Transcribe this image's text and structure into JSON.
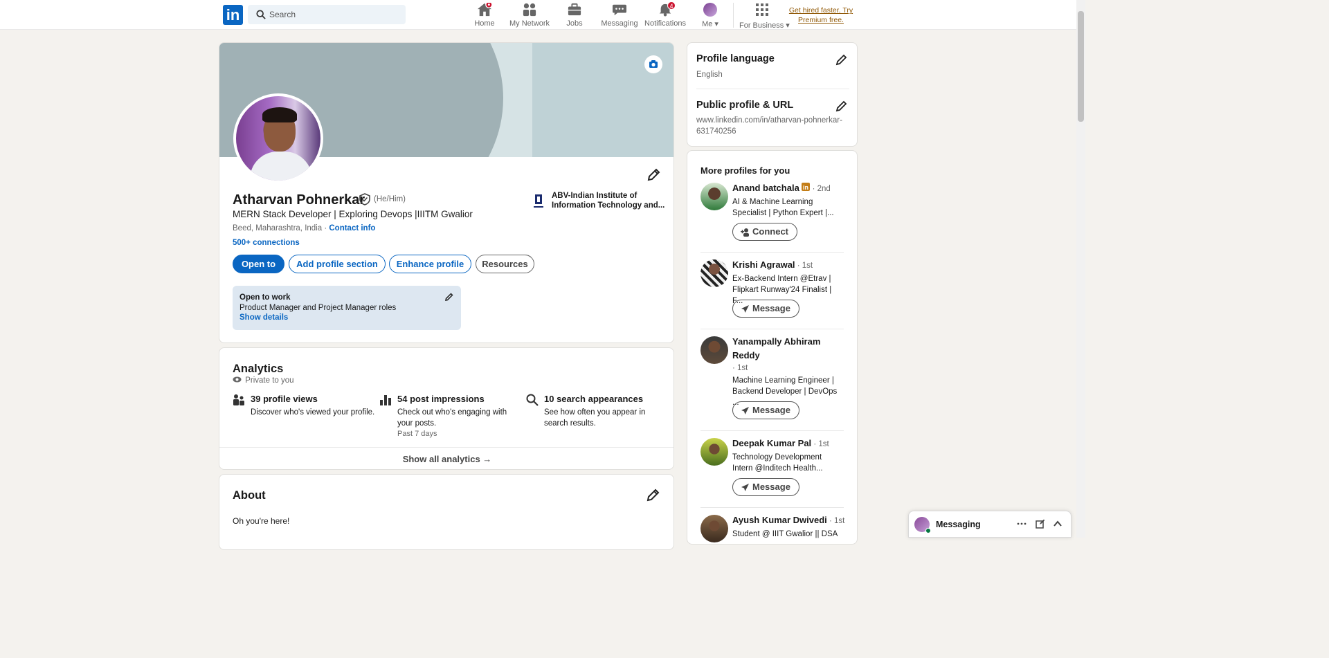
{
  "nav": {
    "search_placeholder": "Search",
    "logo_text": "in",
    "items": [
      {
        "label": "Home",
        "icon": "home-icon",
        "badge": ""
      },
      {
        "label": "My Network",
        "icon": "network-icon",
        "badge": ""
      },
      {
        "label": "Jobs",
        "icon": "briefcase-icon",
        "badge": ""
      },
      {
        "label": "Messaging",
        "icon": "chat-icon",
        "badge": ""
      },
      {
        "label": "Notifications",
        "icon": "bell-icon",
        "badge": "4"
      },
      {
        "label": "Me ▾",
        "icon": "avatar",
        "badge": ""
      },
      {
        "label": "For Business ▾",
        "icon": "grid-icon",
        "badge": ""
      }
    ],
    "premium_text": "Get hired faster. Try Premium free."
  },
  "profile": {
    "name": "Atharvan Pohnerkar",
    "pronouns": "(He/Him)",
    "headline": "MERN Stack Developer | Exploring Devops |IIITM Gwalior",
    "location": "Beed, Maharashtra, India · ",
    "contact_info": "Contact info",
    "connections": "500+ connections",
    "education": "ABV-Indian Institute of",
    "education_line2": "Information Technology and...",
    "buttons": {
      "open_to": "Open to",
      "add_section": "Add profile section",
      "enhance": "Enhance profile",
      "resources": "Resources"
    },
    "open_to_work": {
      "title": "Open to work",
      "roles": "Product Manager and Project Manager roles",
      "show_details": "Show details"
    }
  },
  "analytics": {
    "title": "Analytics",
    "private": "Private to you",
    "stats": [
      {
        "title": "39 profile views",
        "desc": "Discover who's viewed your profile.",
        "extra": ""
      },
      {
        "title": "54 post impressions",
        "desc": "Check out who's engaging with your posts.",
        "extra": "Past 7 days"
      },
      {
        "title": "10 search appearances",
        "desc": "See how often you appear in search results.",
        "extra": ""
      }
    ],
    "show_all": "Show all analytics →"
  },
  "about": {
    "title": "About",
    "text": "Oh you're here!"
  },
  "sidebar": {
    "language_title": "Profile language",
    "language_value": "English",
    "public_title": "Public profile & URL",
    "public_url": "www.linkedin.com/in/atharvan-pohnerkar-631740256",
    "more_title": "More profiles for you",
    "people": [
      {
        "name": "Anand batchala",
        "degree": " · 2nd",
        "headline": "AI & Machine Learning Specialist | Python Expert |...",
        "action": "Connect"
      },
      {
        "name": "Krishi Agrawal",
        "degree": " · 1st",
        "headline": "Ex-Backend Intern @Etrav | Flipkart Runway'24 Finalist | F...",
        "action": "Message"
      },
      {
        "name": "Yanampally Abhiram Reddy",
        "degree": "· 1st",
        "headline": "Machine Learning Engineer | Backend Developer | DevOps ...",
        "action": "Message"
      },
      {
        "name": "Deepak Kumar Pal",
        "degree": " · 1st",
        "headline": "Technology Development Intern @Inditech Health...",
        "action": "Message"
      },
      {
        "name": "Ayush Kumar Dwivedi",
        "degree": " · 1st",
        "headline": "Student @ IIIT Gwalior || DSA",
        "action": ""
      }
    ]
  },
  "messaging": {
    "label": "Messaging"
  },
  "colors": {
    "brand": "#0a66c2",
    "badge": "#cb112d",
    "premium": "#915907",
    "online": "#057642"
  }
}
